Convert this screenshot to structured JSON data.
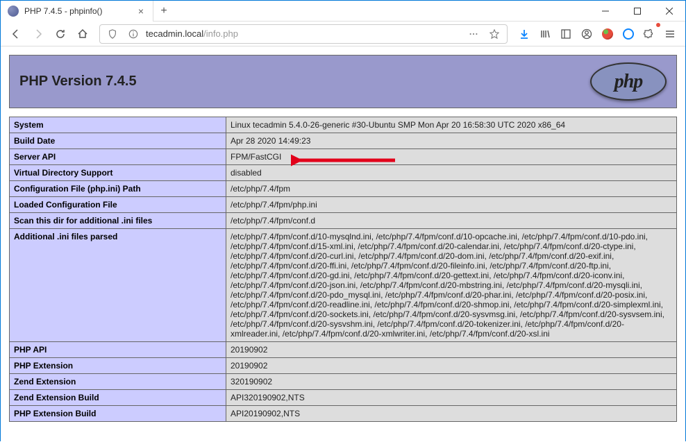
{
  "window": {
    "tab_title": "PHP 7.4.5 - phpinfo()"
  },
  "urlbar": {
    "host": "tecadmin.local",
    "path": "/info.php"
  },
  "phpinfo": {
    "header_title": "PHP Version 7.4.5",
    "logo_text": "php",
    "rows": [
      {
        "key": "System",
        "value": "Linux tecadmin 5.4.0-26-generic #30-Ubuntu SMP Mon Apr 20 16:58:30 UTC 2020 x86_64"
      },
      {
        "key": "Build Date",
        "value": "Apr 28 2020 14:49:23"
      },
      {
        "key": "Server API",
        "value": "FPM/FastCGI"
      },
      {
        "key": "Virtual Directory Support",
        "value": "disabled"
      },
      {
        "key": "Configuration File (php.ini) Path",
        "value": "/etc/php/7.4/fpm"
      },
      {
        "key": "Loaded Configuration File",
        "value": "/etc/php/7.4/fpm/php.ini"
      },
      {
        "key": "Scan this dir for additional .ini files",
        "value": "/etc/php/7.4/fpm/conf.d"
      },
      {
        "key": "Additional .ini files parsed",
        "value": "/etc/php/7.4/fpm/conf.d/10-mysqlnd.ini, /etc/php/7.4/fpm/conf.d/10-opcache.ini, /etc/php/7.4/fpm/conf.d/10-pdo.ini, /etc/php/7.4/fpm/conf.d/15-xml.ini, /etc/php/7.4/fpm/conf.d/20-calendar.ini, /etc/php/7.4/fpm/conf.d/20-ctype.ini, /etc/php/7.4/fpm/conf.d/20-curl.ini, /etc/php/7.4/fpm/conf.d/20-dom.ini, /etc/php/7.4/fpm/conf.d/20-exif.ini, /etc/php/7.4/fpm/conf.d/20-ffi.ini, /etc/php/7.4/fpm/conf.d/20-fileinfo.ini, /etc/php/7.4/fpm/conf.d/20-ftp.ini, /etc/php/7.4/fpm/conf.d/20-gd.ini, /etc/php/7.4/fpm/conf.d/20-gettext.ini, /etc/php/7.4/fpm/conf.d/20-iconv.ini, /etc/php/7.4/fpm/conf.d/20-json.ini, /etc/php/7.4/fpm/conf.d/20-mbstring.ini, /etc/php/7.4/fpm/conf.d/20-mysqli.ini, /etc/php/7.4/fpm/conf.d/20-pdo_mysql.ini, /etc/php/7.4/fpm/conf.d/20-phar.ini, /etc/php/7.4/fpm/conf.d/20-posix.ini, /etc/php/7.4/fpm/conf.d/20-readline.ini, /etc/php/7.4/fpm/conf.d/20-shmop.ini, /etc/php/7.4/fpm/conf.d/20-simplexml.ini, /etc/php/7.4/fpm/conf.d/20-sockets.ini, /etc/php/7.4/fpm/conf.d/20-sysvmsg.ini, /etc/php/7.4/fpm/conf.d/20-sysvsem.ini, /etc/php/7.4/fpm/conf.d/20-sysvshm.ini, /etc/php/7.4/fpm/conf.d/20-tokenizer.ini, /etc/php/7.4/fpm/conf.d/20-xmlreader.ini, /etc/php/7.4/fpm/conf.d/20-xmlwriter.ini, /etc/php/7.4/fpm/conf.d/20-xsl.ini"
      },
      {
        "key": "PHP API",
        "value": "20190902"
      },
      {
        "key": "PHP Extension",
        "value": "20190902"
      },
      {
        "key": "Zend Extension",
        "value": "320190902"
      },
      {
        "key": "Zend Extension Build",
        "value": "API320190902,NTS"
      },
      {
        "key": "PHP Extension Build",
        "value": "API20190902,NTS"
      }
    ]
  }
}
